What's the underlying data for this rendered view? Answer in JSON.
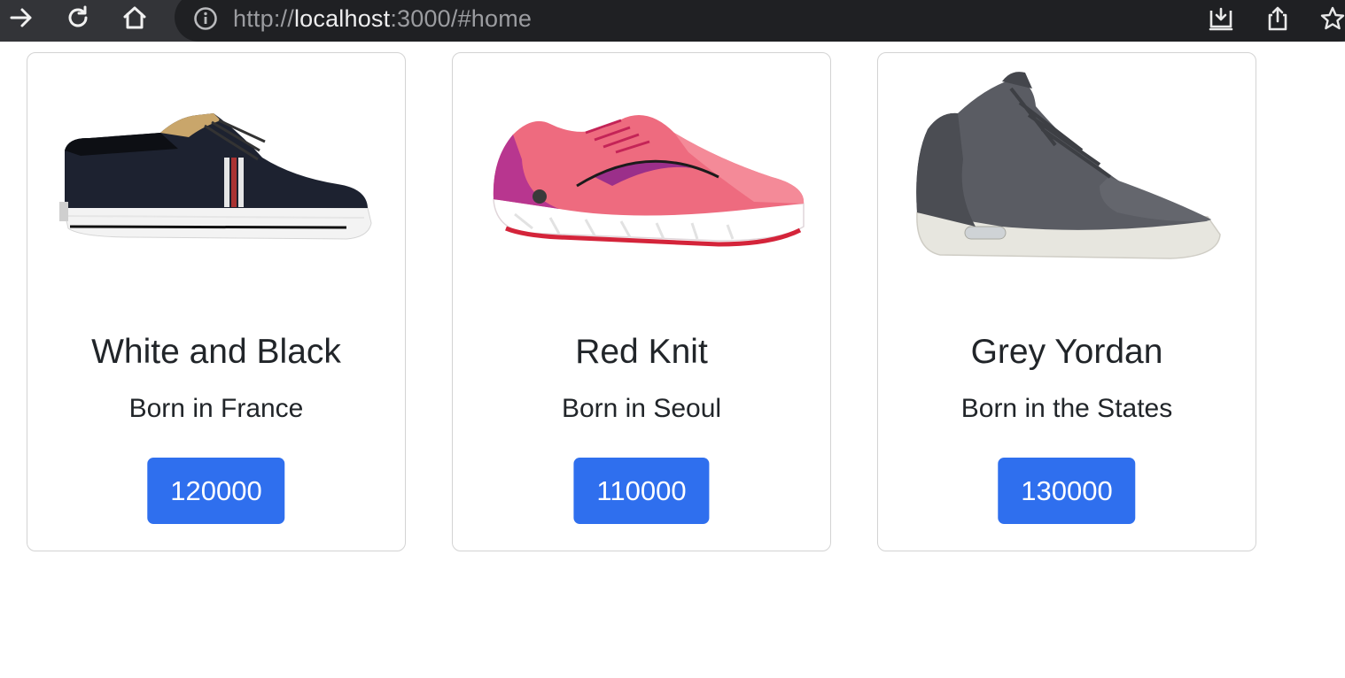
{
  "browser": {
    "url_scheme": "http://",
    "url_host": "localhost",
    "url_rest": ":3000/#home",
    "icons": [
      "forward-icon",
      "reload-icon",
      "home-icon",
      "info-icon",
      "install-icon",
      "share-icon",
      "bookmark-star-icon"
    ]
  },
  "products": [
    {
      "title": "White and Black",
      "description": "Born in France",
      "price": "120000",
      "image_icon": "sneaker-white-black-icon"
    },
    {
      "title": "Red Knit",
      "description": "Born in Seoul",
      "price": "110000",
      "image_icon": "sneaker-red-knit-icon"
    },
    {
      "title": "Grey Yordan",
      "description": "Born in the States",
      "price": "130000",
      "image_icon": "sneaker-grey-yordan-icon"
    }
  ],
  "colors": {
    "chrome_bg": "#333438",
    "url_bg": "#1f2023",
    "button_primary": "#2f6fee",
    "card_border": "#d3d3d3",
    "text_dark": "#212529"
  }
}
